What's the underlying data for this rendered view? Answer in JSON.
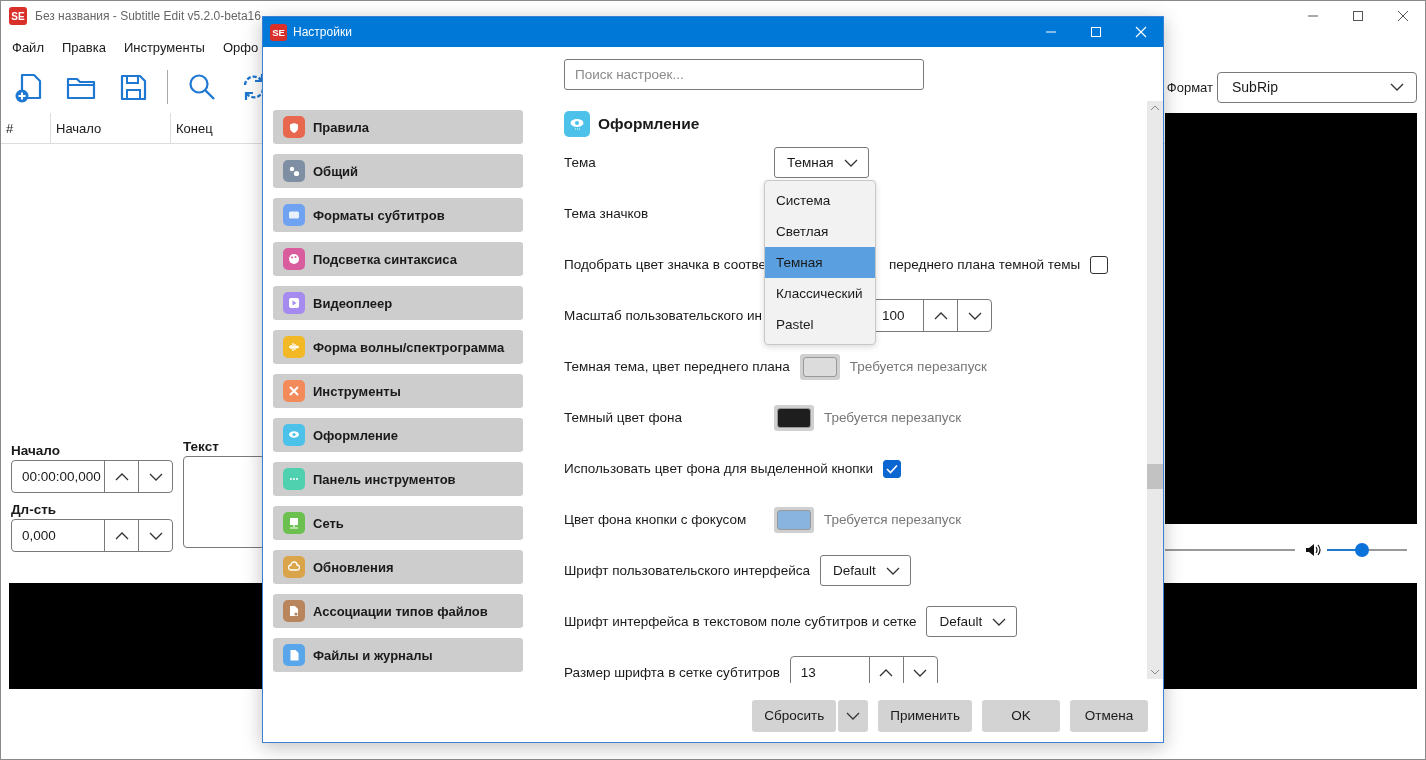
{
  "main_window": {
    "logo": "SE",
    "title": "Без названия - Subtitle Edit v5.2.0-beta16",
    "menu": [
      "Файл",
      "Правка",
      "Инструменты",
      "Орфо"
    ],
    "grid": {
      "columns": [
        "#",
        "Начало",
        "Конец"
      ]
    },
    "format": {
      "label": "Формат",
      "value": "SubRip"
    },
    "start": {
      "label": "Начало",
      "value": "00:00:00,000"
    },
    "duration": {
      "label": "Дл-сть",
      "value": "0,000"
    },
    "text": {
      "label": "Текст"
    },
    "volume": {
      "level": 0.44
    }
  },
  "dialog": {
    "logo": "SE",
    "title": "Настройки",
    "search": {
      "placeholder": "Поиск настроек..."
    },
    "sidebar": {
      "items": [
        {
          "label": "Правила",
          "color": "#e8674f"
        },
        {
          "label": "Общий",
          "color": "#7f8fa3"
        },
        {
          "label": "Форматы субтитров",
          "color": "#6fa3f2"
        },
        {
          "label": "Подсветка синтаксиса",
          "color": "#d95c9e"
        },
        {
          "label": "Видеоплеер",
          "color": "#a58af0"
        },
        {
          "label": "Форма волны/спектрограмма",
          "color": "#f2b826"
        },
        {
          "label": "Инструменты",
          "color": "#f28a5a"
        },
        {
          "label": "Оформление",
          "color": "#4cc1ea"
        },
        {
          "label": "Панель инструментов",
          "color": "#4fd1b0"
        },
        {
          "label": "Сеть",
          "color": "#6cc04f"
        },
        {
          "label": "Обновления",
          "color": "#d9a44a"
        },
        {
          "label": "Ассоциации типов файлов",
          "color": "#b9855c"
        },
        {
          "label": "Файлы и журналы",
          "color": "#5aa6ea"
        }
      ]
    },
    "section": {
      "title": "Оформление"
    },
    "settings": [
      {
        "kind": "combo",
        "label": "Тема",
        "value": "Темная"
      },
      {
        "kind": "plain",
        "label": "Тема значков"
      },
      {
        "kind": "checkbox",
        "label": "Подобрать цвет значка в соотве",
        "label_after": "переднего плана темной темы",
        "checked": false
      },
      {
        "kind": "partspinner",
        "label": "Масштаб пользовательского ин",
        "value": "100"
      },
      {
        "kind": "color",
        "label": "Темная тема, цвет переднего плана",
        "color": "#dcdcdc",
        "note": "Требуется перезапуск"
      },
      {
        "kind": "color",
        "label": "Темный цвет фона",
        "color": "#1e1e1e",
        "note": "Требуется перезапуск"
      },
      {
        "kind": "checkbox",
        "label": "Использовать цвет фона для выделенной кнопки",
        "checked": true
      },
      {
        "kind": "color",
        "label": "Цвет фона кнопки с фокусом",
        "color": "#8ab4e0",
        "note": "Требуется перезапуск"
      },
      {
        "kind": "combo",
        "label": "Шрифт пользовательского интерфейса",
        "value": "Default"
      },
      {
        "kind": "combo",
        "label": "Шрифт интерфейса в текстовом поле субтитров и сетке",
        "value": "Default"
      },
      {
        "kind": "spinner",
        "label": "Размер шрифта в сетке субтитров",
        "value": "13"
      }
    ],
    "popup": {
      "items": [
        {
          "label": "Система",
          "selected": false
        },
        {
          "label": "Светлая",
          "selected": false
        },
        {
          "label": "Темная",
          "selected": true
        },
        {
          "label": "Классический",
          "selected": false
        },
        {
          "label": "Pastel",
          "selected": false
        }
      ]
    },
    "buttons": [
      {
        "label": "Сбросить",
        "kind": "split"
      },
      {
        "label": "Применить",
        "kind": "plain"
      },
      {
        "label": "OK",
        "kind": "plain"
      },
      {
        "label": "Отмена",
        "kind": "plain"
      }
    ]
  }
}
